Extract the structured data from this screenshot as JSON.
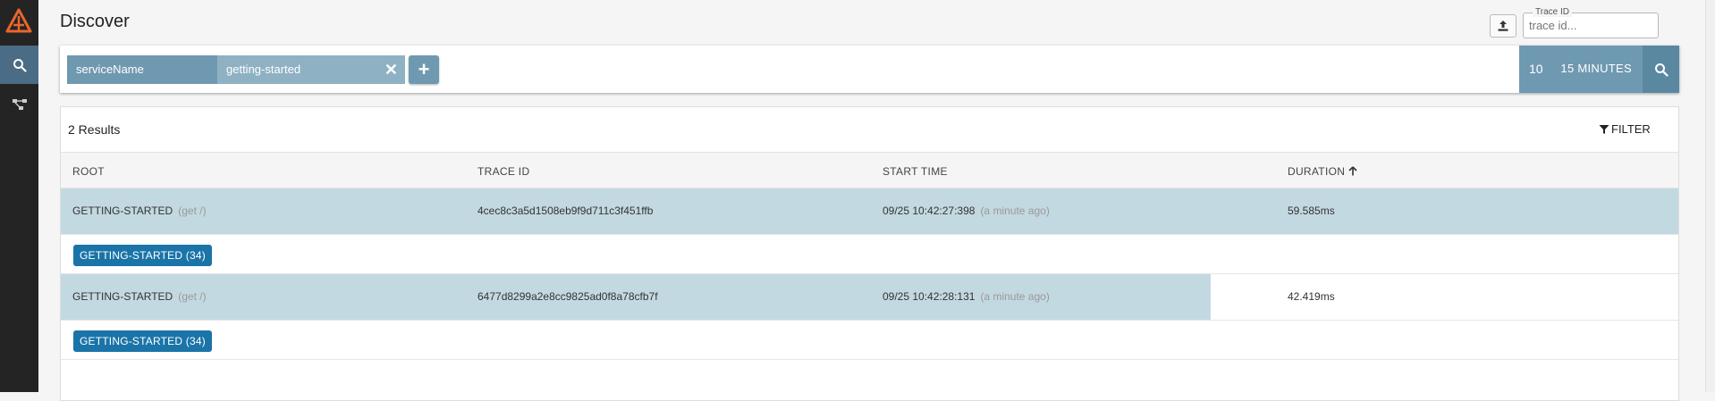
{
  "app": {
    "title": "Discover"
  },
  "header": {
    "trace_id_label": "Trace ID",
    "trace_id_placeholder": "trace id..."
  },
  "search": {
    "criteria": [
      {
        "key": "serviceName",
        "value": "getting-started"
      }
    ],
    "limit": "10",
    "lookback": "15 MINUTES"
  },
  "results": {
    "count_label": "2 Results",
    "filter_label": "FILTER",
    "columns": [
      "ROOT",
      "TRACE ID",
      "START TIME",
      "DURATION"
    ],
    "rows": [
      {
        "root": "GETTING-STARTED",
        "span": "(get /)",
        "trace_id": "4cec8c3a5d1508eb9f9d711c3f451ffb",
        "start_time": "09/25 10:42:27:398",
        "relative": "(a minute ago)",
        "duration": "59.585ms",
        "duration_fraction": 1.0,
        "badge": "GETTING-STARTED (34)"
      },
      {
        "root": "GETTING-STARTED",
        "span": "(get /)",
        "trace_id": "6477d8299a2e8cc9825ad0f8a78cfb7f",
        "start_time": "09/25 10:42:28:131",
        "relative": "(a minute ago)",
        "duration": "42.419ms",
        "duration_fraction": 0.711,
        "badge": "GETTING-STARTED (34)"
      }
    ]
  },
  "colors": {
    "sidebar": "#242424",
    "accent": "#6f99b1",
    "row_bar": "#c3d9e1",
    "badge": "#1a74a8",
    "logo": "#e8662d"
  }
}
